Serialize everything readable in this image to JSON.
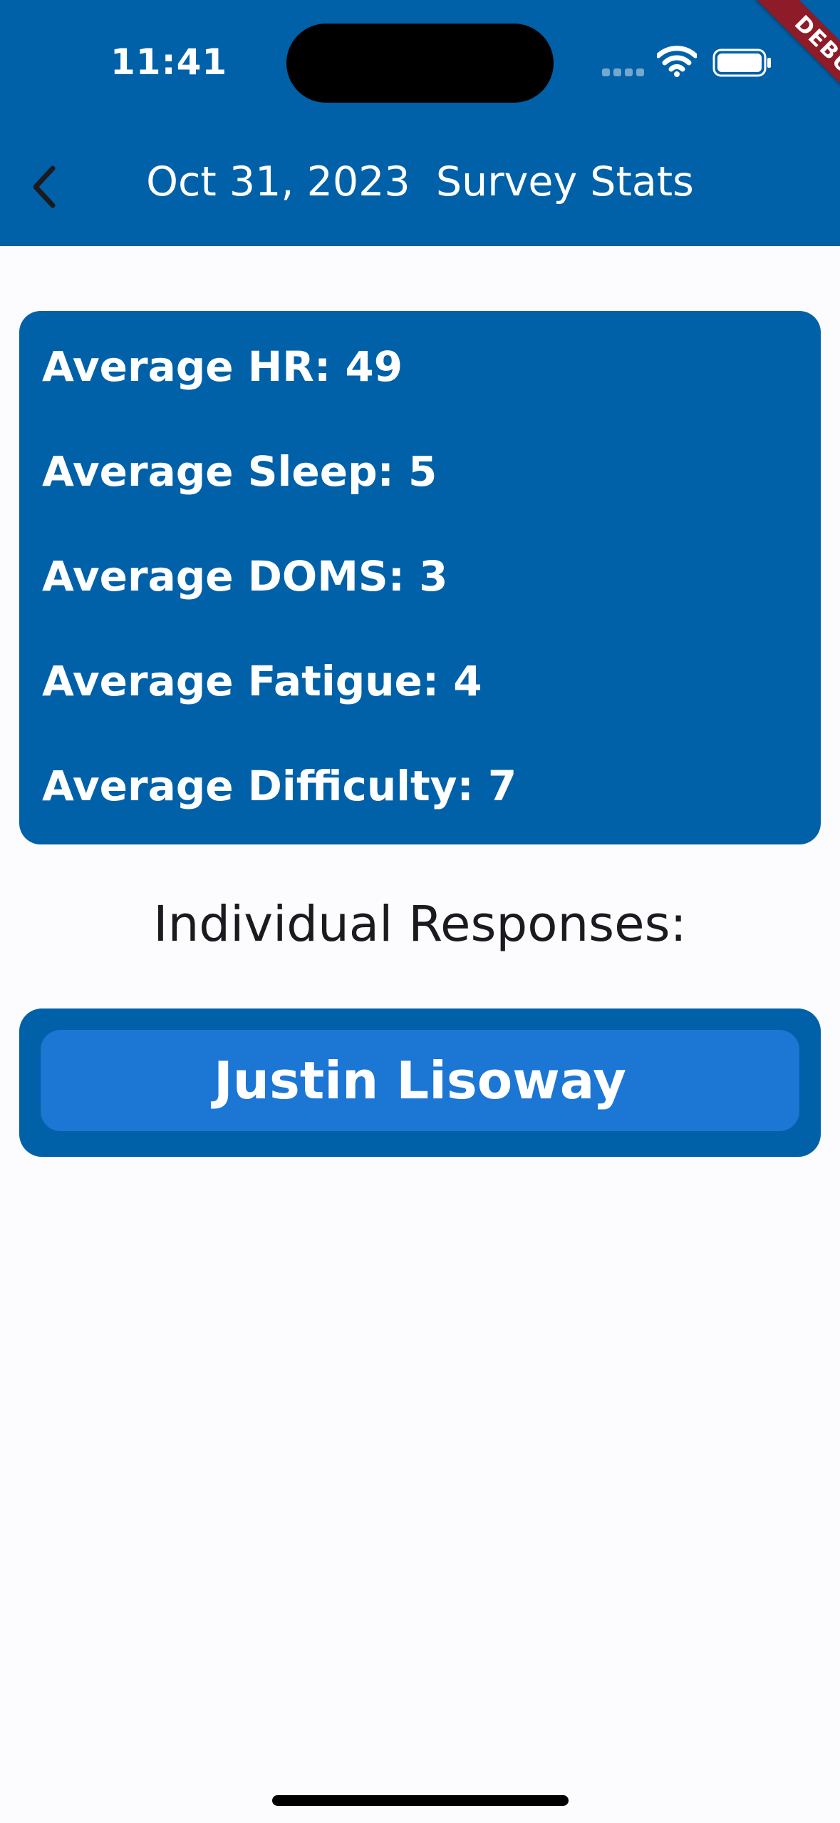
{
  "status_bar": {
    "time": "11:41",
    "signal_icon": "cellular-signal-icon",
    "wifi_icon": "wifi-icon",
    "battery_icon": "battery-icon"
  },
  "debug_banner": "DEBUG",
  "app_bar": {
    "back_icon": "chevron-left-icon",
    "title": "Oct 31, 2023  Survey Stats"
  },
  "stats": {
    "items": [
      "Average HR: 49",
      "Average Sleep: 5",
      "Average DOMS: 3",
      "Average Fatigue: 4",
      "Average Difficulty: 7"
    ]
  },
  "responses": {
    "heading": "Individual Responses:",
    "items": [
      {
        "name": "Justin Lisoway"
      }
    ]
  },
  "colors": {
    "primary": "#0061A8",
    "button": "#1B76D4",
    "background": "#FCFCFF",
    "text_dark": "#1B1B1F",
    "debug_banner": "#8E1B28"
  }
}
